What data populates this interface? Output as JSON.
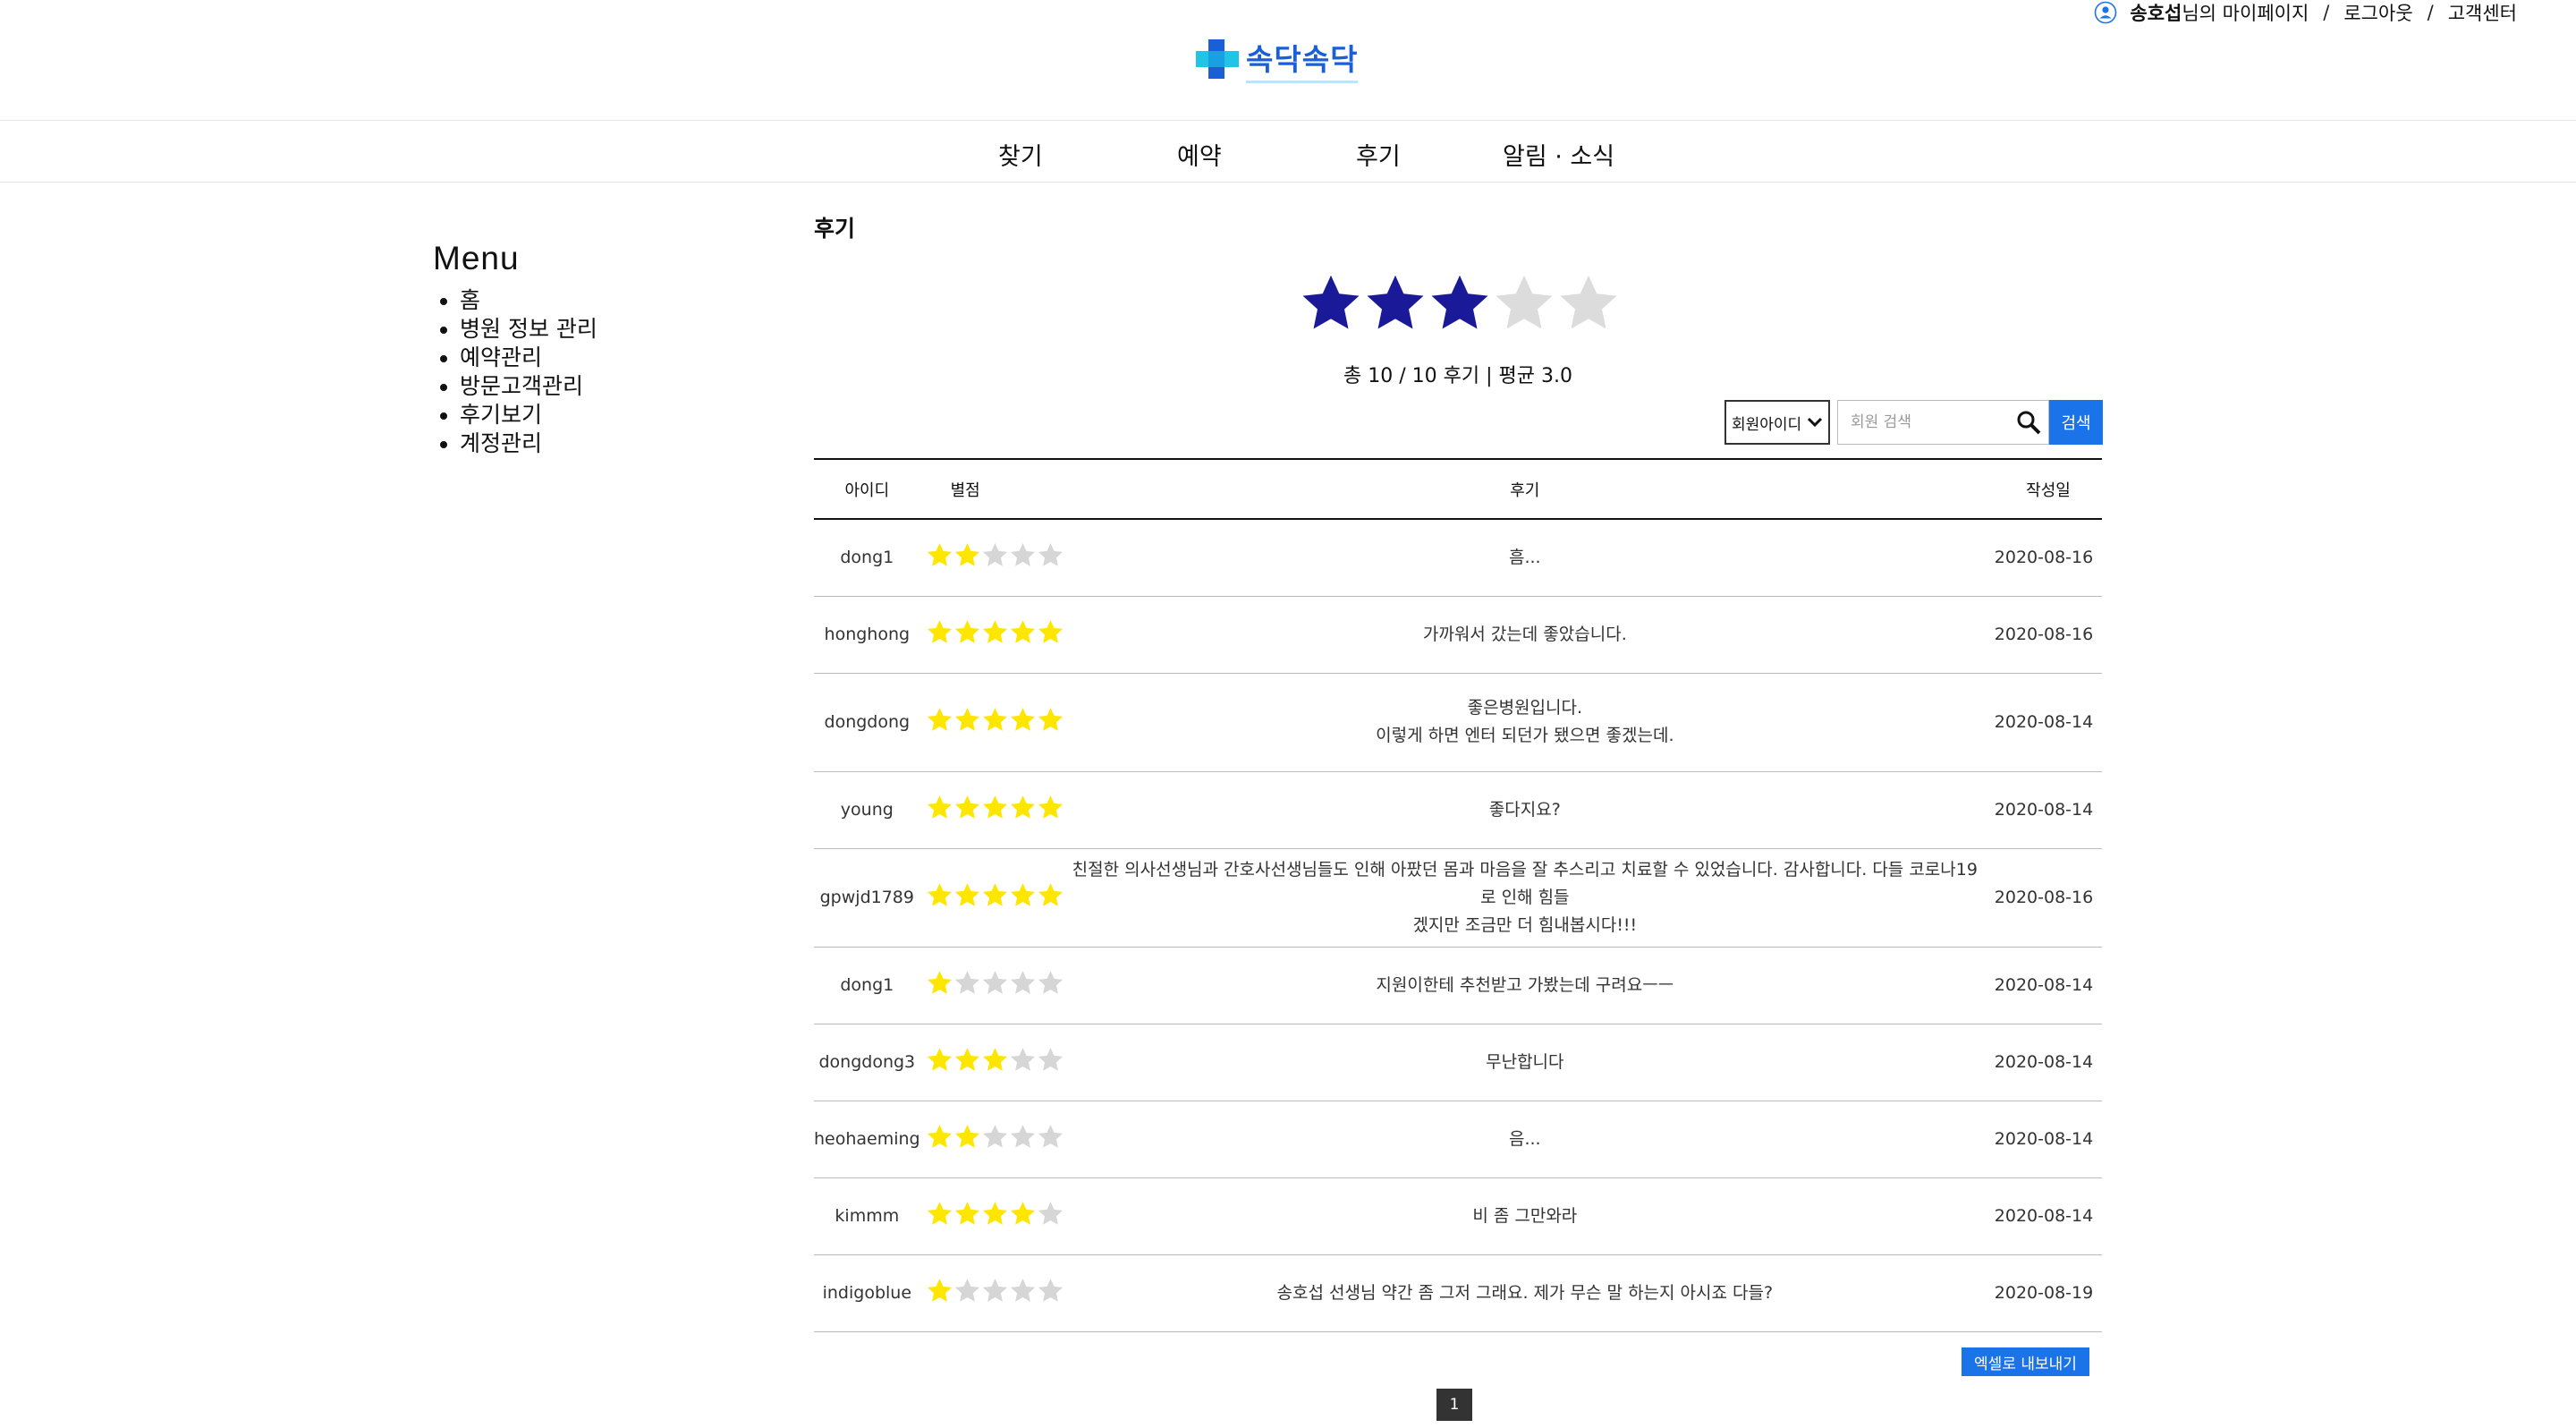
{
  "header": {
    "user_name": "송호섭",
    "user_suffix": "님의 마이페이지",
    "logout": "로그아웃",
    "support": "고객센터",
    "separator": "/",
    "logo_text": "속닥속닥"
  },
  "nav": {
    "items": [
      {
        "label": "찾기"
      },
      {
        "label": "예약"
      },
      {
        "label": "후기"
      },
      {
        "label": "알림 · 소식"
      }
    ]
  },
  "sidebar": {
    "title": "Menu",
    "items": [
      {
        "label": "홈"
      },
      {
        "label": "병원 정보 관리"
      },
      {
        "label": "예약관리"
      },
      {
        "label": "방문고객관리"
      },
      {
        "label": "후기보기"
      },
      {
        "label": "계정관리"
      }
    ]
  },
  "main": {
    "title": "후기",
    "average_rating": 3.0,
    "max_rating": 5,
    "summary": "총 10 / 10 후기 | 평균 3.0",
    "search": {
      "select_value": "회원아이디",
      "placeholder": "회원 검색",
      "button": "검색"
    },
    "table": {
      "headers": {
        "id": "아이디",
        "rating": "별점",
        "review": "후기",
        "date": "작성일"
      },
      "rows": [
        {
          "id": "dong1",
          "rating": 2,
          "lines": [
            "흠..."
          ],
          "date": "2020-08-16"
        },
        {
          "id": "honghong",
          "rating": 5,
          "lines": [
            "가까워서 갔는데 좋았습니다."
          ],
          "date": "2020-08-16"
        },
        {
          "id": "dongdong",
          "rating": 5,
          "lines": [
            "좋은병원입니다.",
            "이렇게 하면 엔터 되던가 됐으면 좋겠는데."
          ],
          "date": "2020-08-14"
        },
        {
          "id": "young",
          "rating": 5,
          "lines": [
            "좋다지요?"
          ],
          "date": "2020-08-14"
        },
        {
          "id": "gpwjd1789",
          "rating": 5,
          "lines": [
            "친절한 의사선생님과 간호사선생님들도 인해 아팠던 몸과 마음을 잘 추스리고 치료할 수 있었습니다. 감사합니다. 다들 코로나19로 인해 힘들",
            "겠지만 조금만 더 힘내봅시다!!!"
          ],
          "date": "2020-08-16"
        },
        {
          "id": "dong1",
          "rating": 1,
          "lines": [
            "지원이한테 추천받고 가봤는데 구려요ㅡㅡ"
          ],
          "date": "2020-08-14"
        },
        {
          "id": "dongdong3",
          "rating": 3,
          "lines": [
            "무난합니다"
          ],
          "date": "2020-08-14"
        },
        {
          "id": "heohaeming",
          "rating": 2,
          "lines": [
            "음..."
          ],
          "date": "2020-08-14"
        },
        {
          "id": "kimmm",
          "rating": 4,
          "lines": [
            "비 좀 그만와라"
          ],
          "date": "2020-08-14"
        },
        {
          "id": "indigoblue",
          "rating": 1,
          "lines": [
            "송호섭 선생님 약간 좀 그저 그래요. 제가 무슨 말 하는지 아시죠 다들?"
          ],
          "date": "2020-08-19"
        }
      ]
    },
    "export_button": "엑셀로 내보내기",
    "pagination": {
      "current": "1"
    }
  },
  "colors": {
    "big_star_filled": "#1a1a99",
    "big_star_empty": "#dcdcdc",
    "small_star_filled": "#ffe600",
    "small_star_empty": "#d6d6d6",
    "accent_blue": "#1a73e8",
    "logo_blue": "#1b5fd6",
    "logo_cross": "#22c3e6"
  }
}
